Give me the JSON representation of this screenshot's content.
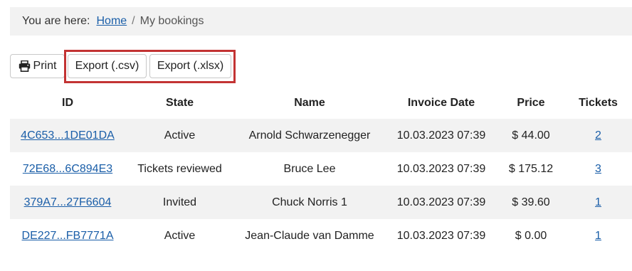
{
  "breadcrumb": {
    "prefix": "You are here:",
    "home": "Home",
    "separator": "/",
    "current": "My bookings"
  },
  "toolbar": {
    "print_label": "Print",
    "print_icon": "printer-icon",
    "export_csv_label": "Export (.csv)",
    "export_xlsx_label": "Export (.xlsx)",
    "highlight_color": "#c33333"
  },
  "table": {
    "headers": {
      "id": "ID",
      "state": "State",
      "name": "Name",
      "invoice_date": "Invoice Date",
      "price": "Price",
      "tickets": "Tickets"
    },
    "rows": [
      {
        "id": "4C653...1DE01DA",
        "state": "Active",
        "name": "Arnold Schwarzenegger",
        "invoice_date": "10.03.2023 07:39",
        "price": "$ 44.00",
        "tickets": "2"
      },
      {
        "id": "72E68...6C894E3",
        "state": "Tickets reviewed",
        "name": "Bruce Lee",
        "invoice_date": "10.03.2023 07:39",
        "price": "$ 175.12",
        "tickets": "3"
      },
      {
        "id": "379A7...27F6604",
        "state": "Invited",
        "name": "Chuck Norris 1",
        "invoice_date": "10.03.2023 07:39",
        "price": "$ 39.60",
        "tickets": "1"
      },
      {
        "id": "DE227...FB7771A",
        "state": "Active",
        "name": "Jean-Claude van Damme",
        "invoice_date": "10.03.2023 07:39",
        "price": "$ 0.00",
        "tickets": "1"
      }
    ]
  }
}
